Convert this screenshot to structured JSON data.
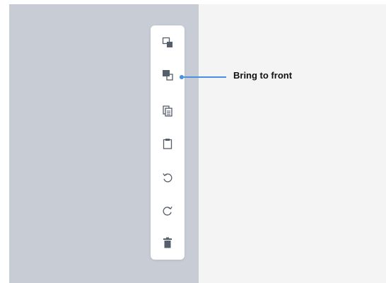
{
  "toolbar": {
    "tools": [
      {
        "name": "send-to-back-icon"
      },
      {
        "name": "bring-to-front-icon"
      },
      {
        "name": "copy-icon"
      },
      {
        "name": "paste-icon"
      },
      {
        "name": "undo-icon"
      },
      {
        "name": "redo-icon"
      },
      {
        "name": "delete-icon"
      }
    ]
  },
  "callout": {
    "label": "Bring to front",
    "color": "#4a90e2"
  },
  "colors": {
    "canvas": "#c7ccd5",
    "panel": "#f4f4f4",
    "icon": "#555e6b"
  }
}
